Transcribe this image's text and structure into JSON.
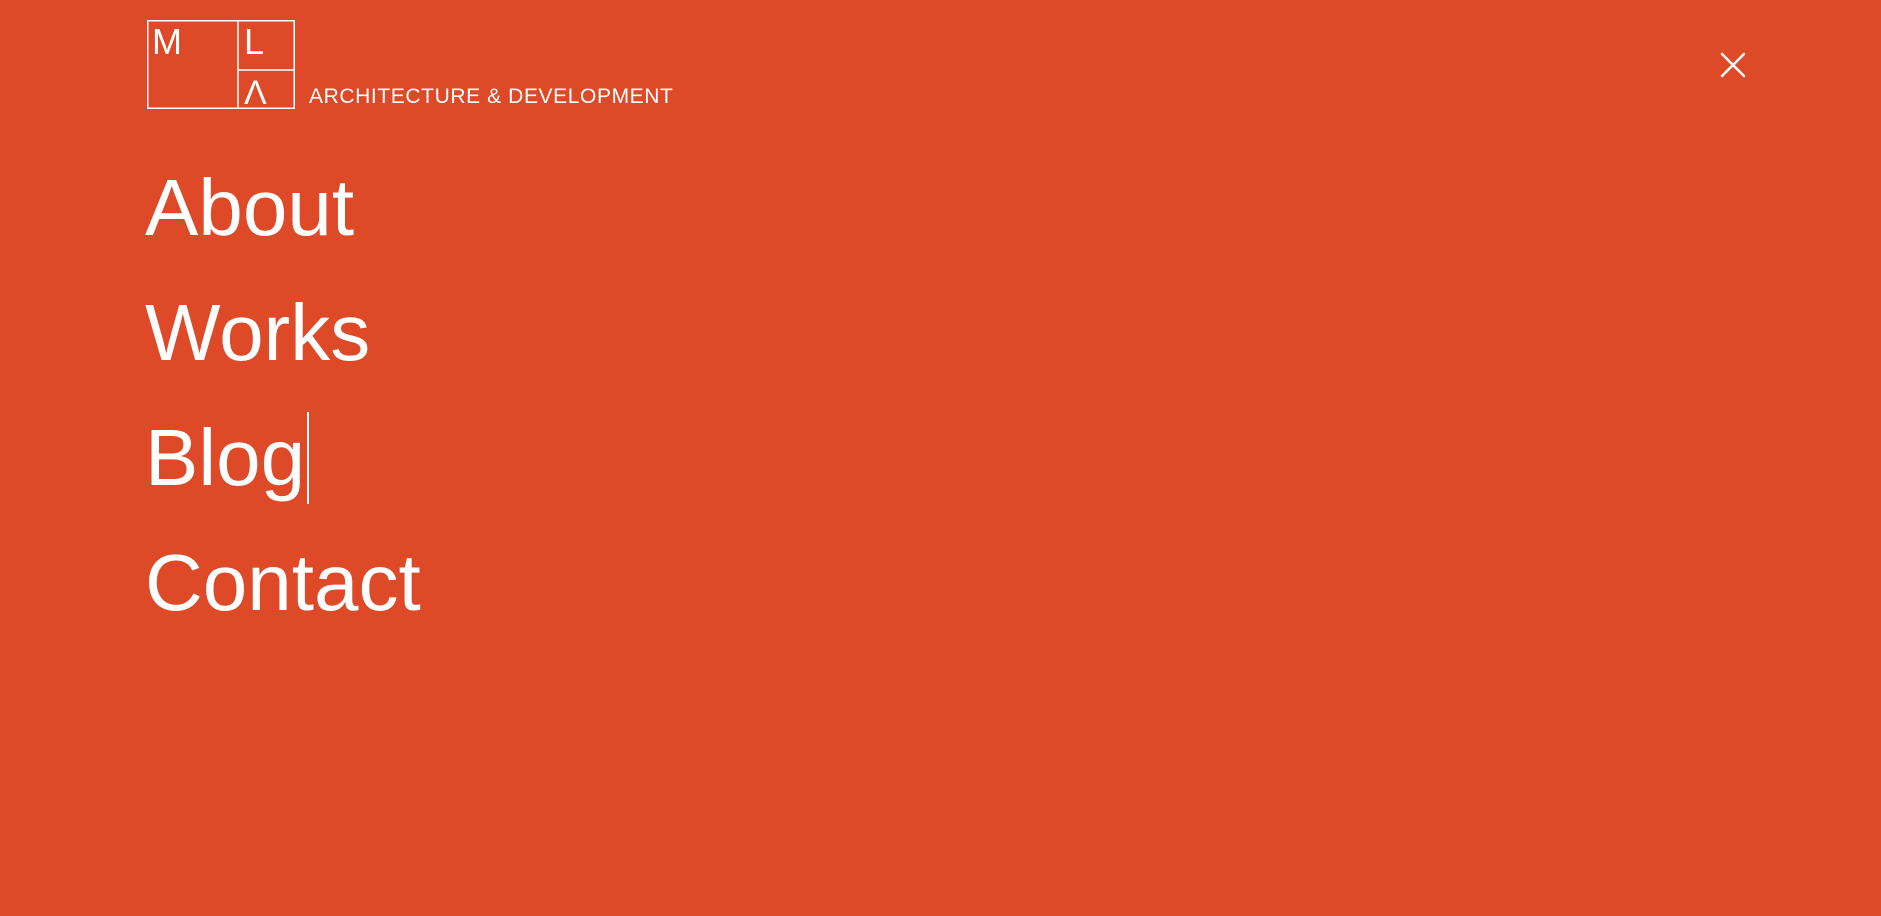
{
  "brand": {
    "monogram": [
      "M",
      "L",
      "Λ"
    ],
    "tagline": "ARCHITECTURE & DEVELOPMENT"
  },
  "menu": {
    "close_icon": "close-icon",
    "items": [
      {
        "label": "About"
      },
      {
        "label": "Works"
      },
      {
        "label": "Blog"
      },
      {
        "label": "Contact"
      }
    ]
  },
  "colors": {
    "background": "#DE4927",
    "foreground": "#FFFFFF"
  }
}
